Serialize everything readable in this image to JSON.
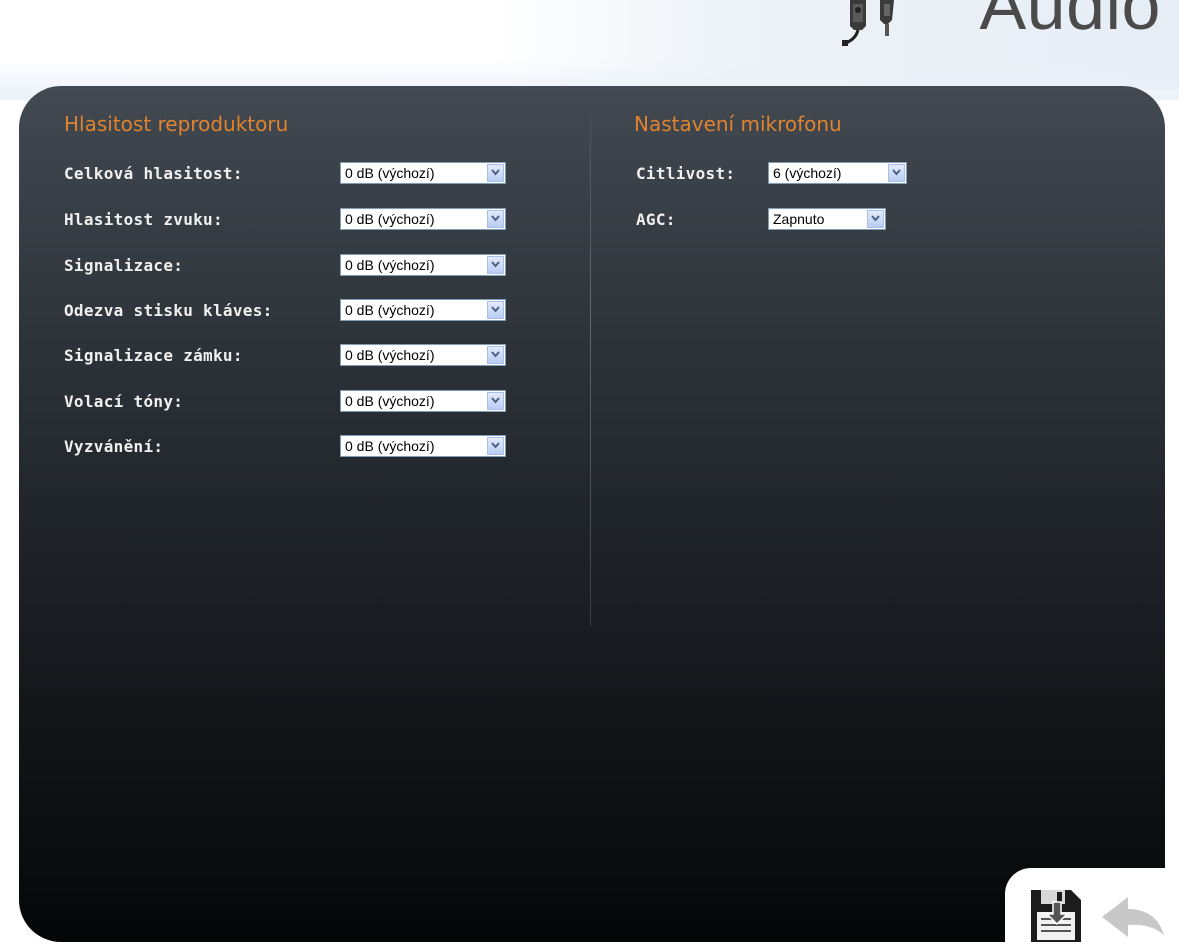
{
  "header": {
    "title": "Audio",
    "icons": [
      "speaker-icon",
      "microphone-icon"
    ]
  },
  "speaker_section": {
    "title": "Hlasitost reproduktoru",
    "rows": [
      {
        "label": "Celková hlasitost:",
        "value": "0 dB (výchozí)"
      },
      {
        "label": "Hlasitost zvuku:",
        "value": "0 dB (výchozí)"
      },
      {
        "label": "Signalizace:",
        "value": "0 dB (výchozí)"
      },
      {
        "label": "Odezva stisku kláves:",
        "value": "0 dB (výchozí)"
      },
      {
        "label": "Signalizace zámku:",
        "value": "0 dB (výchozí)"
      },
      {
        "label": "Volací tóny:",
        "value": "0 dB (výchozí)"
      },
      {
        "label": "Vyzvánění:",
        "value": "0 dB (výchozí)"
      }
    ]
  },
  "mic_section": {
    "title": "Nastavení mikrofonu",
    "rows": [
      {
        "label": "Citlivost:",
        "value": "6 (výchozí)"
      },
      {
        "label": "AGC:",
        "value": "Zapnuto"
      }
    ]
  },
  "actions": {
    "save_icon": "save-icon",
    "back_icon": "back-arrow-icon"
  },
  "colors": {
    "accent": "#e0832e",
    "panel_top": "#424951",
    "panel_bottom": "#050607"
  }
}
